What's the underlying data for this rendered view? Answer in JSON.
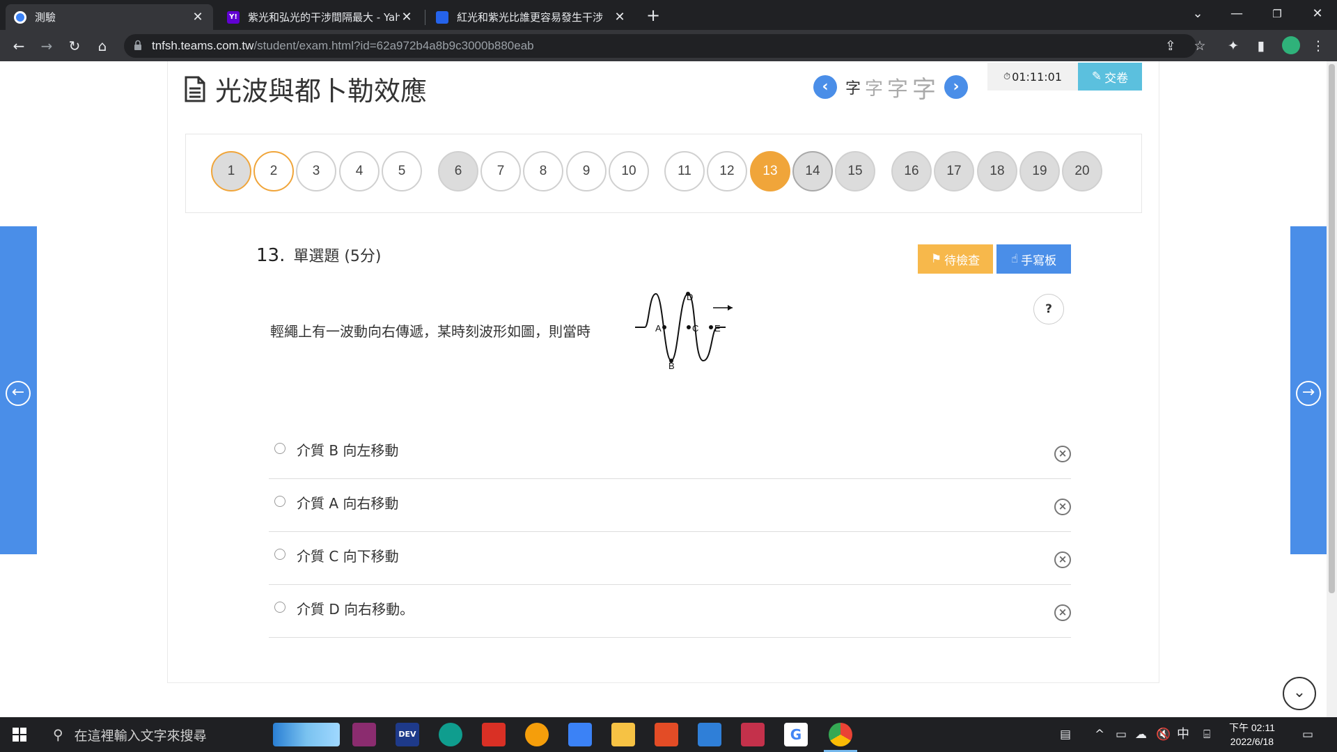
{
  "browser": {
    "tabs": [
      {
        "title": "測驗",
        "active": true
      },
      {
        "title": "紫光和弘光的干涉間隔最大 - Yah"
      },
      {
        "title": "紅光和紫光比誰更容易發生干涉"
      }
    ],
    "url_host": "tnfsh.teams.com.tw",
    "url_path": "/student/exam.html?id=62a972b4a8b9c3000b880eab"
  },
  "exam": {
    "title": "光波與都卜勒效應",
    "font_sizes": [
      "字",
      "字",
      "字",
      "字"
    ],
    "timer": "01:11:01",
    "submit_label": "交卷",
    "question_numbers": [
      "1",
      "2",
      "3",
      "4",
      "5",
      "6",
      "7",
      "8",
      "9",
      "10",
      "11",
      "12",
      "13",
      "14",
      "15",
      "16",
      "17",
      "18",
      "19",
      "20"
    ],
    "current_question": "13"
  },
  "question": {
    "number": "13.",
    "type": "單選題 (5分)",
    "pending_label": "待檢查",
    "handwriting_label": "手寫板",
    "help": "?",
    "stem": "輕繩上有一波動向右傳遞，某時刻波形如圖，則當時",
    "wave_labels": [
      "A",
      "B",
      "C",
      "D",
      "E"
    ],
    "options": [
      "介質 B 向左移動",
      "介質 A 向右移動",
      "介質 C 向下移動",
      "介質 D 向右移動。"
    ]
  },
  "taskbar": {
    "search_placeholder": "在這裡輸入文字來搜尋",
    "ime": "中",
    "time": "下午 02:11",
    "date": "2022/6/18"
  }
}
